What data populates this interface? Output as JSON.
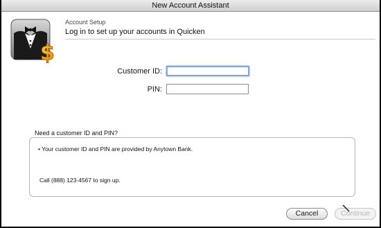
{
  "window": {
    "title": "New Account Assistant"
  },
  "header": {
    "section": "Account Setup",
    "title": "Log in to set up your accounts in Quicken"
  },
  "logo": {
    "icon": "butler-tuxedo-dollar-icon"
  },
  "form": {
    "customer_id_label": "Customer ID:",
    "customer_id_value": "",
    "pin_label": "PIN:",
    "pin_value": ""
  },
  "help": {
    "heading": "Need a customer ID and PIN?",
    "line1": "• Your customer ID and PIN are provided by Anytown Bank.",
    "line2": "Call (888) 123-4567 to sign up."
  },
  "buttons": {
    "cancel": "Cancel",
    "continue": "Continue"
  }
}
